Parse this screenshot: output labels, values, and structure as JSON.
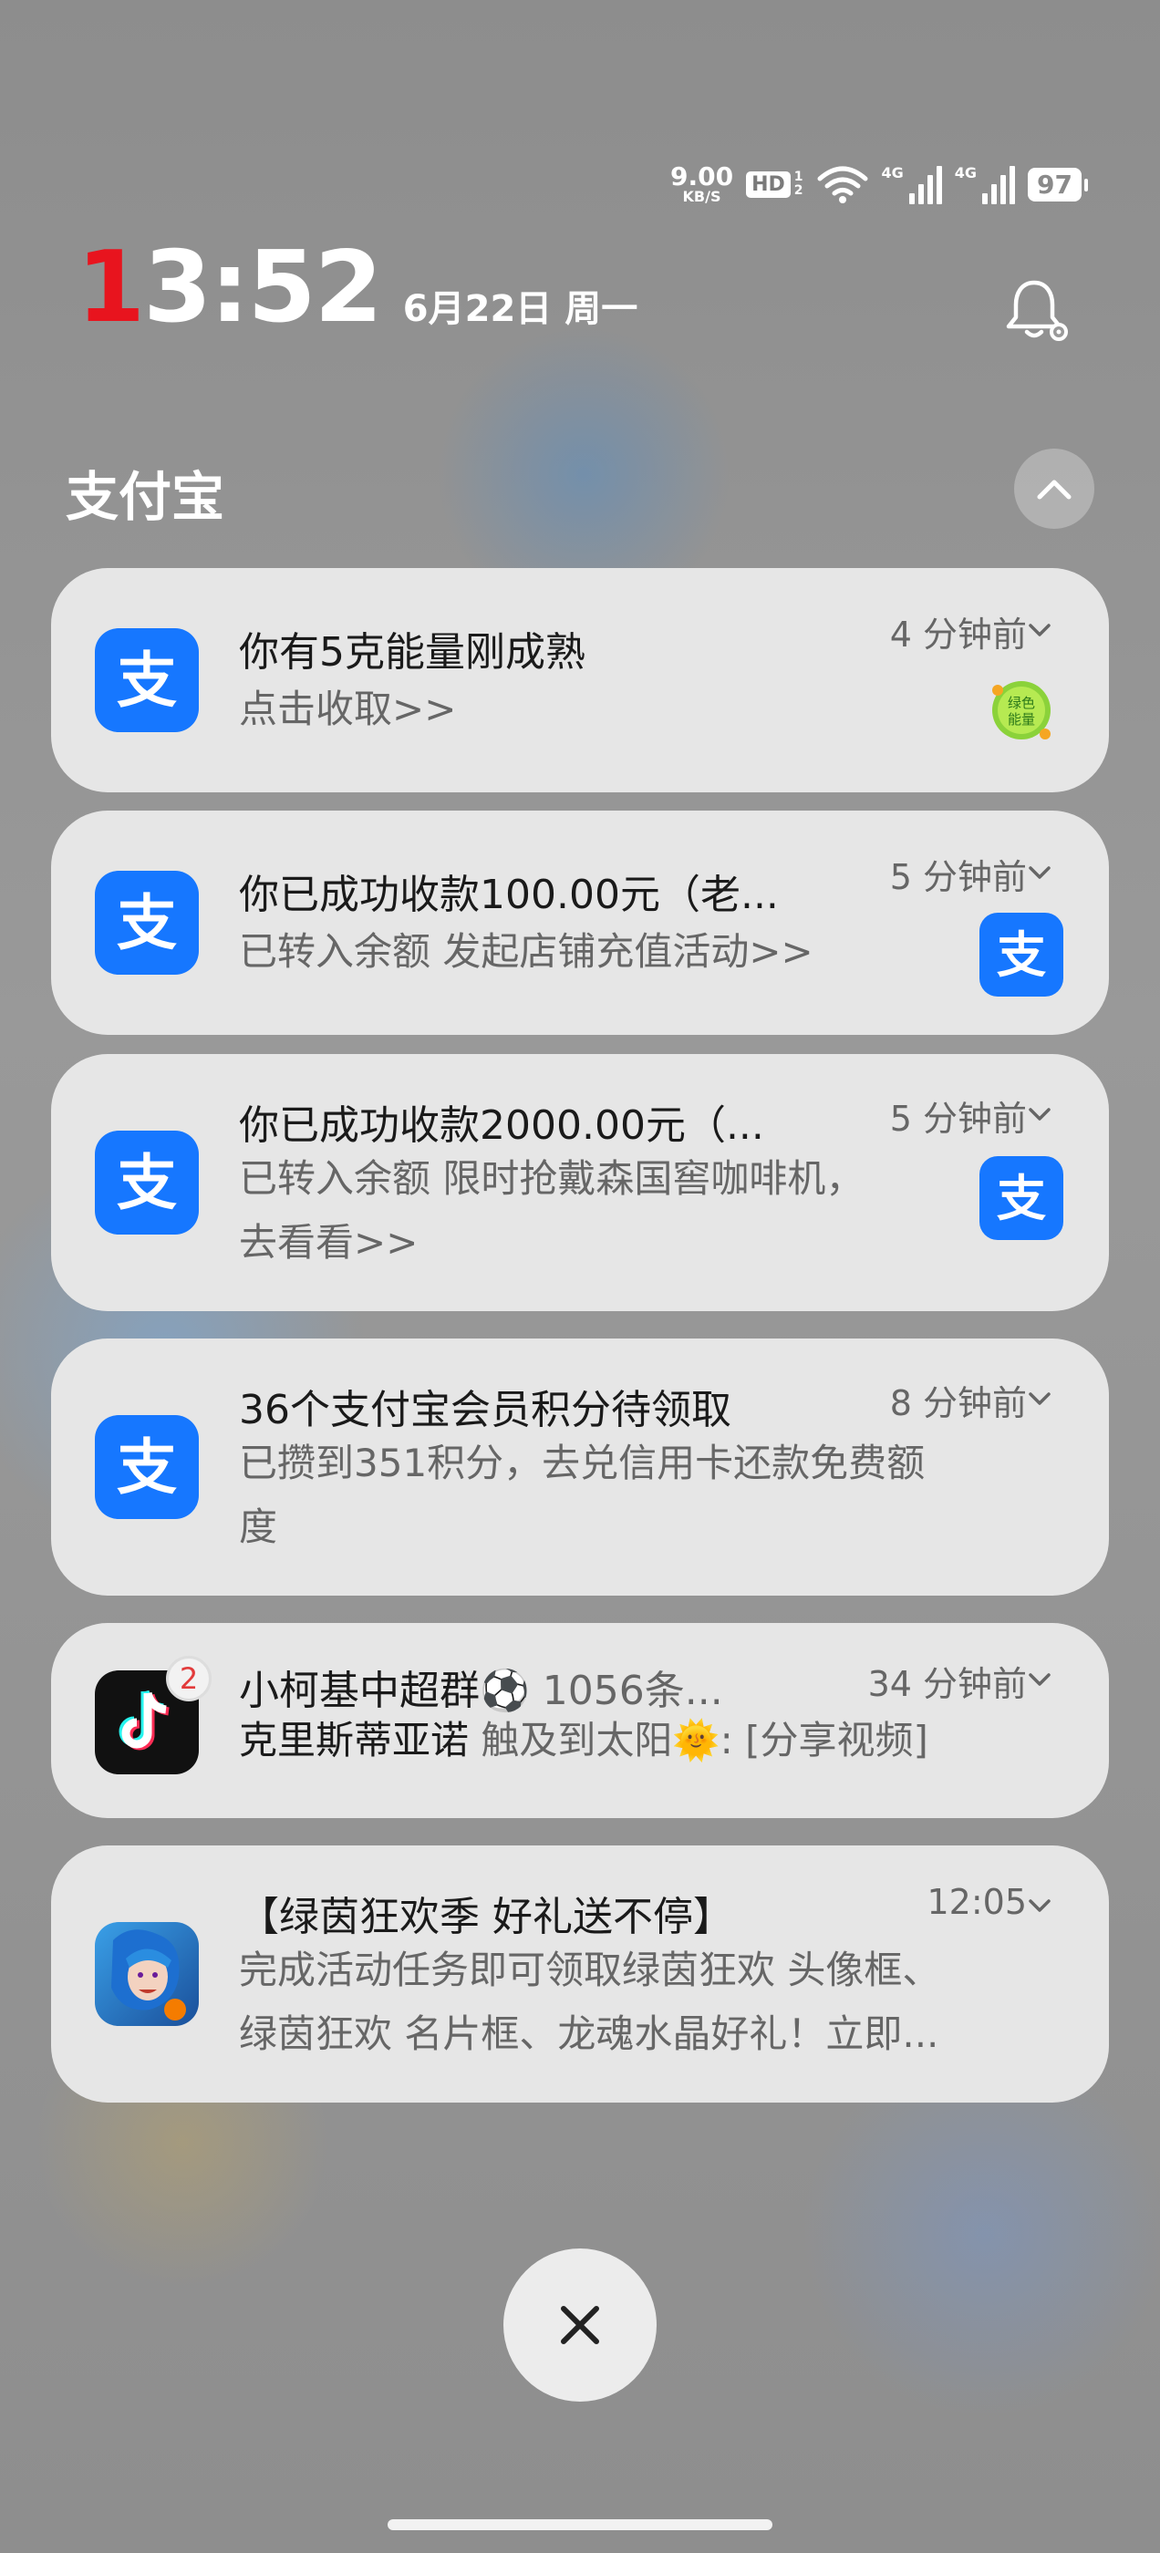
{
  "status_bar": {
    "net_speed_value": "9.00",
    "net_speed_unit": "KB/S",
    "hd_label": "HD",
    "hd_sims": [
      "1",
      "2"
    ],
    "signal_1_label": "4G",
    "signal_2_label": "4G",
    "battery": "97",
    "icons": [
      "wifi-icon",
      "signal-icon",
      "battery-icon"
    ]
  },
  "lockscreen": {
    "time_first": "1",
    "time_rest": "3:52",
    "date": "6月22日 周一",
    "bell_icon": "bell-settings-icon"
  },
  "group": {
    "title": "支付宝",
    "collapse_icon": "chevron-up-icon"
  },
  "notifications": [
    {
      "app_icon": "alipay-icon",
      "title": "你有5克能量刚成熟",
      "body": "点击收取>>",
      "time": "4 分钟前",
      "thumbnail": "green-energy-icon",
      "thumbnail_text": [
        "绿色",
        "能量"
      ]
    },
    {
      "app_icon": "alipay-icon",
      "title": "你已成功收款100.00元（老...",
      "body": "已转入余额 发起店铺充值活动>>",
      "time": "5 分钟前",
      "thumbnail": "alipay-icon"
    },
    {
      "app_icon": "alipay-icon",
      "title": "你已成功收款2000.00元（...",
      "body_lines": [
        "已转入余额 限时抢戴森国窖咖啡机，",
        "去看看>>"
      ],
      "time": "5 分钟前",
      "thumbnail": "alipay-icon"
    },
    {
      "app_icon": "alipay-icon",
      "title": "36个支付宝会员积分待领取",
      "body_lines": [
        "已攒到351积分，去兑信用卡还款免费额",
        "度"
      ],
      "time": "8 分钟前"
    },
    {
      "app_icon": "tiktok-icon",
      "badge": "2",
      "title_main": "小柯基中超群⚽",
      "title_sub": " 1056条...",
      "sender": "克里斯蒂亚诺",
      "message": " 触及到太阳🌞: [分享视频]",
      "time": "34 分钟前"
    },
    {
      "app_icon": "game-character-icon",
      "title": "【绿茵狂欢季 好礼送不停】",
      "body_lines": [
        "完成活动任务即可领取绿茵狂欢 头像框、",
        "绿茵狂欢 名片框、龙魂水晶好礼！立即..."
      ],
      "time": "12:05"
    }
  ],
  "dismiss_icon": "close-icon",
  "colors": {
    "alipay_blue": "#1677ff",
    "clock_red": "#e8141e",
    "card_bg": "#e6e6e6"
  }
}
